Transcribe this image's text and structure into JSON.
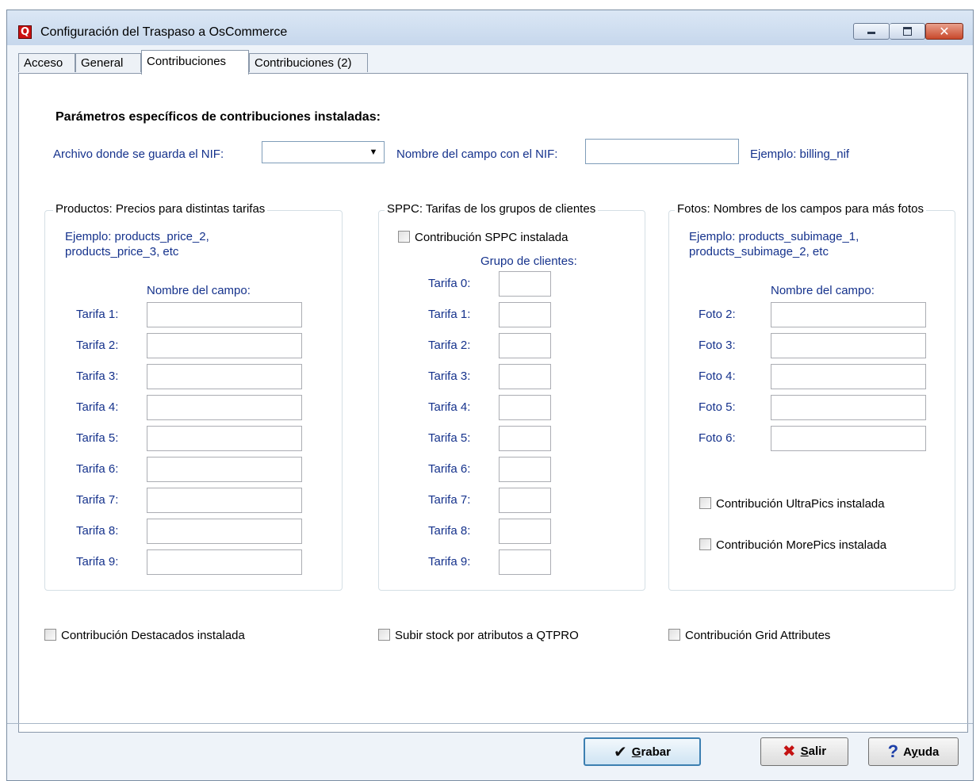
{
  "window": {
    "title": "Configuración del Traspaso a OsCommerce",
    "icon": "q-app-icon",
    "controls": [
      "minimize-icon",
      "maximize-icon",
      "close-icon"
    ]
  },
  "tabs": [
    {
      "label": "Acceso",
      "active": false
    },
    {
      "label": "General",
      "active": false
    },
    {
      "label": "Contribuciones",
      "active": true
    },
    {
      "label": "Contribuciones (2)",
      "active": false
    }
  ],
  "main": {
    "heading": "Parámetros específicos de contribuciones instaladas:",
    "nif_file_label": "Archivo donde se guarda el NIF:",
    "nif_file_value": "",
    "nif_field_label": "Nombre del campo con el NIF:",
    "nif_field_value": "",
    "nif_example": "Ejemplo: billing_nif"
  },
  "productos": {
    "legend": "Productos: Precios para distintas tarifas",
    "example_line1": "Ejemplo: products_price_2,",
    "example_line2": "products_price_3, etc",
    "column_header": "Nombre del campo:",
    "rows": [
      {
        "label": "Tarifa 1:",
        "value": ""
      },
      {
        "label": "Tarifa 2:",
        "value": ""
      },
      {
        "label": "Tarifa 3:",
        "value": ""
      },
      {
        "label": "Tarifa 4:",
        "value": ""
      },
      {
        "label": "Tarifa 5:",
        "value": ""
      },
      {
        "label": "Tarifa 6:",
        "value": ""
      },
      {
        "label": "Tarifa 7:",
        "value": ""
      },
      {
        "label": "Tarifa 8:",
        "value": ""
      },
      {
        "label": "Tarifa 9:",
        "value": ""
      }
    ]
  },
  "sppc": {
    "legend": "SPPC: Tarifas de los grupos de clientes",
    "checkbox_label": "Contribución SPPC instalada",
    "checked": false,
    "column_header": "Grupo de clientes:",
    "rows": [
      {
        "label": "Tarifa 0:",
        "value": ""
      },
      {
        "label": "Tarifa 1:",
        "value": ""
      },
      {
        "label": "Tarifa 2:",
        "value": ""
      },
      {
        "label": "Tarifa 3:",
        "value": ""
      },
      {
        "label": "Tarifa 4:",
        "value": ""
      },
      {
        "label": "Tarifa 5:",
        "value": ""
      },
      {
        "label": "Tarifa 6:",
        "value": ""
      },
      {
        "label": "Tarifa 7:",
        "value": ""
      },
      {
        "label": "Tarifa 8:",
        "value": ""
      },
      {
        "label": "Tarifa 9:",
        "value": ""
      }
    ]
  },
  "fotos": {
    "legend": "Fotos: Nombres de los campos para más fotos",
    "example_line1": "Ejemplo: products_subimage_1,",
    "example_line2": "products_subimage_2,  etc",
    "column_header": "Nombre del campo:",
    "rows": [
      {
        "label": "Foto 2:",
        "value": ""
      },
      {
        "label": "Foto 3:",
        "value": ""
      },
      {
        "label": "Foto 4:",
        "value": ""
      },
      {
        "label": "Foto 5:",
        "value": ""
      },
      {
        "label": "Foto 6:",
        "value": ""
      }
    ],
    "ultrapics_label": "Contribución UltraPics instalada",
    "morepics_label": "Contribución MorePics instalada"
  },
  "bottom_checks": {
    "destacados": "Contribución Destacados instalada",
    "qtpro": "Subir stock por atributos a QTPRO",
    "grid": "Contribución Grid Attributes"
  },
  "buttons": {
    "grabar_accel": "G",
    "grabar_rest": "rabar",
    "salir_accel": "S",
    "salir_rest": "alir",
    "ayuda_pre": "A",
    "ayuda_accel": "y",
    "ayuda_rest": "uda"
  },
  "colors": {
    "label_blue": "#15328c",
    "accent": "#3c7fb1"
  }
}
